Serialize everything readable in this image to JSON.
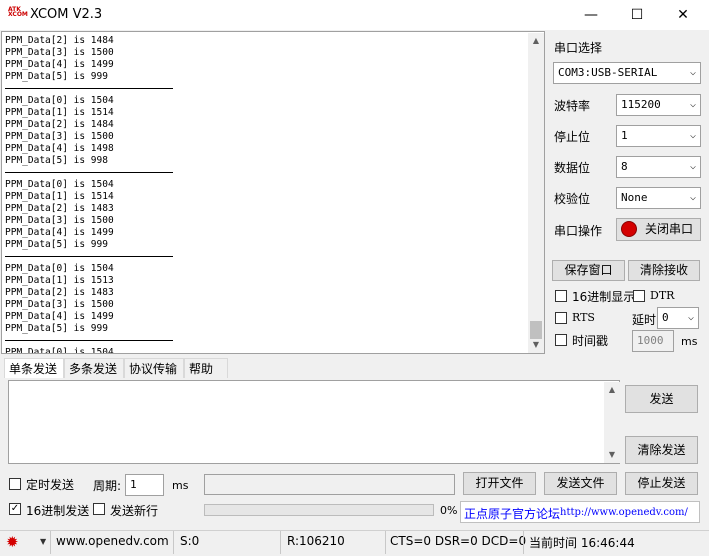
{
  "window": {
    "title": "XCOM V2.3",
    "logo_text": "ATK XCOM",
    "minimize": "—",
    "maximize": "☐",
    "close": "✕"
  },
  "receive": {
    "lines": [
      "PPM_Data[2] is 1484",
      "PPM_Data[3] is 1500",
      "PPM_Data[4] is 1499",
      "PPM_Data[5] is 999",
      "---",
      "PPM_Data[0] is 1504",
      "PPM_Data[1] is 1514",
      "PPM_Data[2] is 1484",
      "PPM_Data[3] is 1500",
      "PPM_Data[4] is 1498",
      "PPM_Data[5] is 998",
      "---",
      "PPM_Data[0] is 1504",
      "PPM_Data[1] is 1514",
      "PPM_Data[2] is 1483",
      "PPM_Data[3] is 1500",
      "PPM_Data[4] is 1499",
      "PPM_Data[5] is 999",
      "---",
      "PPM_Data[0] is 1504",
      "PPM_Data[1] is 1513",
      "PPM_Data[2] is 1483",
      "PPM_Data[3] is 1500",
      "PPM_Data[4] is 1499",
      "PPM_Data[5] is 999",
      "---",
      "PPM_Data[0] is 1504"
    ]
  },
  "serial": {
    "select_label": "串口选择",
    "port": "COM3:USB-SERIAL",
    "baud_label": "波特率",
    "baud": "115200",
    "stop_label": "停止位",
    "stop": "1",
    "data_label": "数据位",
    "data": "8",
    "parity_label": "校验位",
    "parity": "None",
    "op_label": "串口操作",
    "close_port": "关闭串口",
    "save_window": "保存窗口",
    "clear_receive": "清除接收",
    "hex_display": "16进制显示",
    "dtr": "DTR",
    "rts": "RTS",
    "delay_label": "延时",
    "delay": "0",
    "timestamp": "时间戳",
    "timestamp_ms": "1000",
    "ms": "ms"
  },
  "tabs": [
    "单条发送",
    "多条发送",
    "协议传输",
    "帮助"
  ],
  "send": {
    "send_button": "发送",
    "clear_send": "清除发送",
    "timed_send": "定时发送",
    "period_label": "周期:",
    "period": "1",
    "period_unit": "ms",
    "open_file": "打开文件",
    "send_file": "发送文件",
    "stop_send": "停止发送",
    "hex_send": "16进制发送",
    "send_newline": "发送新行",
    "progress": "0%",
    "forum_link": "正点原子官方论坛",
    "forum_url": "http://www.openedv.com/"
  },
  "statusbar": {
    "site": "www.openedv.com",
    "s": "S:0",
    "r": "R:106210",
    "lines": "CTS=0 DSR=0 DCD=0",
    "time": "当前时间 16:46:44"
  },
  "colors": {
    "accent_red": "#d40000",
    "link_blue": "#0000ff"
  }
}
